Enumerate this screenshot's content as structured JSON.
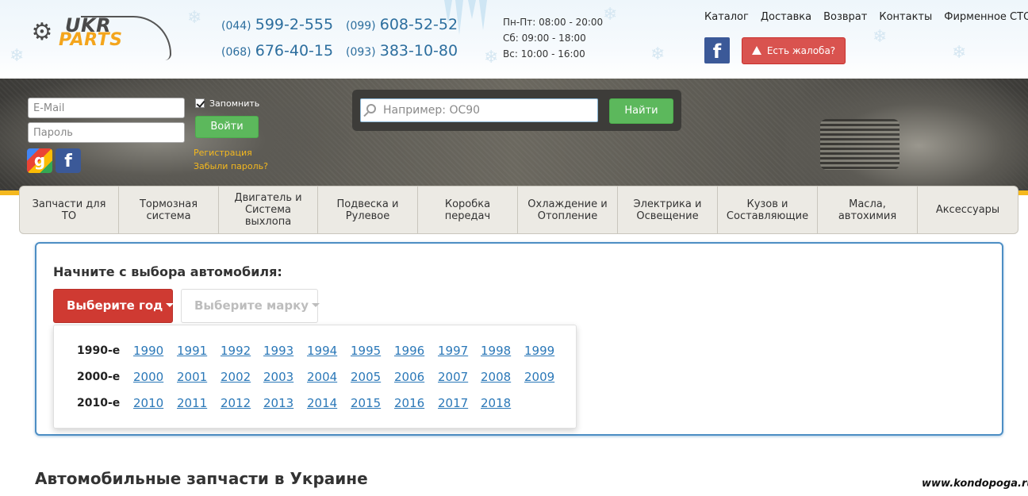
{
  "logo": {
    "ukr": "UKR",
    "parts": "PARTS"
  },
  "phones": [
    {
      "code": "(044)",
      "number": "599-2-555"
    },
    {
      "code": "(099)",
      "number": "608-52-52"
    },
    {
      "code": "(068)",
      "number": "676-40-15"
    },
    {
      "code": "(093)",
      "number": "383-10-80"
    }
  ],
  "hours": [
    "Пн-Пт: 08:00 - 20:00",
    "Сб: 09:00 - 18:00",
    "Вс: 10:00 - 16:00"
  ],
  "top_nav": [
    "Каталог",
    "Доставка",
    "Возврат",
    "Контакты",
    "Фирменное СТО"
  ],
  "complain_label": "Есть жалоба?",
  "facebook_letter": "f",
  "google_letter": "g",
  "login": {
    "email_placeholder": "E-Mail",
    "password_placeholder": "Пароль",
    "remember_label": "Запомнить",
    "login_button": "Войти",
    "register_link": "Регистрация",
    "forgot_link": "Забыли пароль?"
  },
  "search": {
    "placeholder": "Например: OC90",
    "button": "Найти"
  },
  "categories": [
    "Запчасти для ТО",
    "Тормозная система",
    "Двигатель и Система выхлопа",
    "Подвеска и Рулевое",
    "Коробка передач",
    "Охлаждение и Отопление",
    "Электрика и Освещение",
    "Кузов и Составляющие",
    "Масла, автохимия",
    "Аксессуары"
  ],
  "car_select": {
    "title": "Начните с выбора автомобиля:",
    "year_button": "Выберите год",
    "brand_button": "Выберите марку",
    "decades": [
      {
        "label": "1990-е",
        "years": [
          "1990",
          "1991",
          "1992",
          "1993",
          "1994",
          "1995",
          "1996",
          "1997",
          "1998",
          "1999"
        ]
      },
      {
        "label": "2000-е",
        "years": [
          "2000",
          "2001",
          "2002",
          "2003",
          "2004",
          "2005",
          "2006",
          "2007",
          "2008",
          "2009"
        ]
      },
      {
        "label": "2010-е",
        "years": [
          "2010",
          "2011",
          "2012",
          "2013",
          "2014",
          "2015",
          "2016",
          "2017",
          "2018"
        ]
      }
    ]
  },
  "section_title": "Автомобильные запчасти в Украине",
  "watermark": "www.kondopoga.ru",
  "colors": {
    "link_blue": "#2b78b8",
    "green_button": "#5cb85c",
    "red_button": "#cf3a32",
    "accent_yellow": "#f4b81e",
    "panel_border": "#4d8ec4",
    "facebook": "#3b5998"
  }
}
